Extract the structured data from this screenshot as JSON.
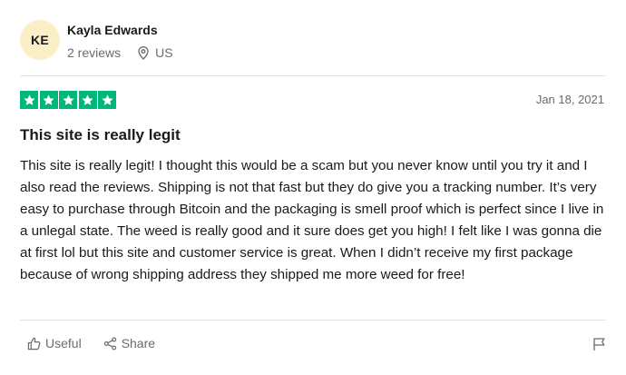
{
  "author": {
    "initials": "KE",
    "name": "Kayla Edwards",
    "reviews": "2 reviews",
    "country": "US",
    "avatar_color": "#fbefc7"
  },
  "review": {
    "rating": 5,
    "rating_max": 5,
    "star_color": "#00b67a",
    "date": "Jan 18, 2021",
    "title": "This site is really legit",
    "body": "This site is really legit! I thought this would be a scam but you never know until you try it and I also read the reviews. Shipping is not that fast but they do give you a tracking number. It’s very easy to purchase through Bitcoin and the packaging is smell proof which is perfect since I live in a unlegal state. The weed is really good and it sure does get you high! I felt like I was gonna die at first lol but this site and customer service is great. When I didn’t receive my first package because of wrong shipping address they shipped me more weed for free!"
  },
  "actions": {
    "useful_label": "Useful",
    "share_label": "Share",
    "useful_icon": "thumbs-up-icon",
    "share_icon": "share-icon",
    "flag_icon": "flag-icon",
    "location_icon": "location-pin-icon"
  }
}
